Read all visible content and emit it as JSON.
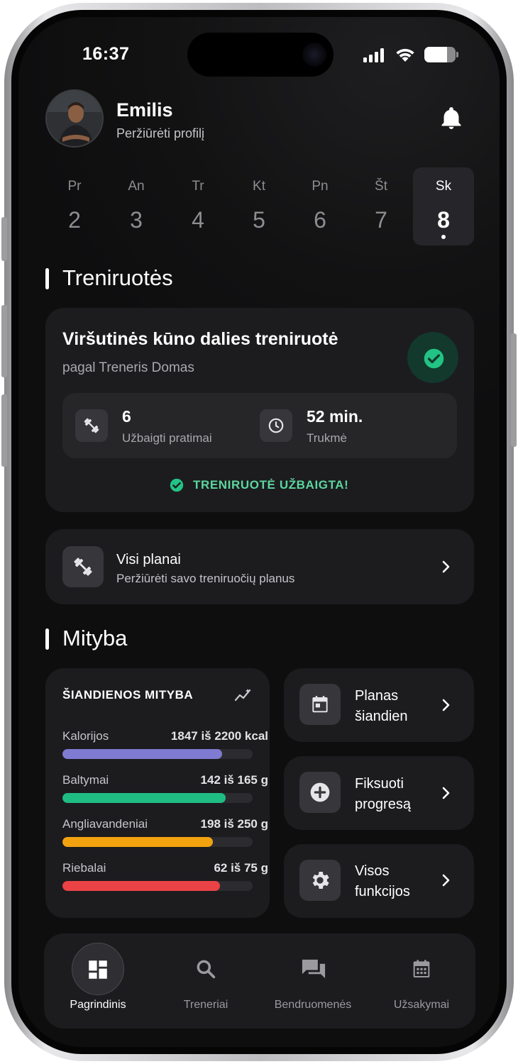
{
  "status_bar": {
    "time": "16:37",
    "battery_level": 0.72
  },
  "header": {
    "name": "Emilis",
    "subtitle": "Peržiūrėti profilį"
  },
  "days": [
    {
      "abbr": "Pr",
      "num": "2"
    },
    {
      "abbr": "An",
      "num": "3"
    },
    {
      "abbr": "Tr",
      "num": "4"
    },
    {
      "abbr": "Kt",
      "num": "5"
    },
    {
      "abbr": "Pn",
      "num": "6"
    },
    {
      "abbr": "Št",
      "num": "7"
    },
    {
      "abbr": "Sk",
      "num": "8",
      "selected": true
    }
  ],
  "workouts": {
    "section_title": "Treniruotės",
    "card": {
      "title": "Viršutinės kūno dalies treniruotė",
      "by": "pagal Treneris Domas",
      "stats": [
        {
          "value": "6",
          "label": "Užbaigti pratimai",
          "icon": "dumbbell-icon"
        },
        {
          "value": "52 min.",
          "label": "Trukmė",
          "icon": "clock-icon"
        }
      ],
      "status": "TRENIRUOTĖ UŽBAIGTA!"
    },
    "plans": {
      "title": "Visi planai",
      "subtitle": "Peržiūrėti savo treniruočių planus"
    }
  },
  "nutrition": {
    "section_title": "Mityba",
    "today": {
      "title": "ŠIANDIENOS MITYBA",
      "rows": [
        {
          "label": "Kalorijos",
          "value": "1847 iš 2200 kcal",
          "fraction": 0.84,
          "color": "#7f7ad2"
        },
        {
          "label": "Baltymai",
          "value": "142 iš 165 g",
          "fraction": 0.86,
          "color": "#1fbd83"
        },
        {
          "label": "Angliavandeniai",
          "value": "198 iš 250 g",
          "fraction": 0.79,
          "color": "#f3a20f"
        },
        {
          "label": "Riebalai",
          "value": "62 iš 75 g",
          "fraction": 0.83,
          "color": "#ea4245"
        }
      ]
    },
    "actions": [
      {
        "line1": "Planas",
        "line2": "šiandien",
        "icon": "calendar-icon"
      },
      {
        "line1": "Fiksuoti",
        "line2": "progresą",
        "icon": "plus-circle-icon"
      },
      {
        "line1": "Visos",
        "line2": "funkcijos",
        "icon": "gear-icon"
      }
    ]
  },
  "nav": [
    {
      "label": "Pagrindinis",
      "icon": "dashboard-icon",
      "active": true
    },
    {
      "label": "Treneriai",
      "icon": "search-icon"
    },
    {
      "label": "Bendruomenės",
      "icon": "chat-icon"
    },
    {
      "label": "Užsakymai",
      "icon": "calendar-icon"
    }
  ],
  "colors": {
    "accent_green": "#22c384",
    "status_green_text": "#5cd69e",
    "card_bg": "#1c1c1f"
  }
}
